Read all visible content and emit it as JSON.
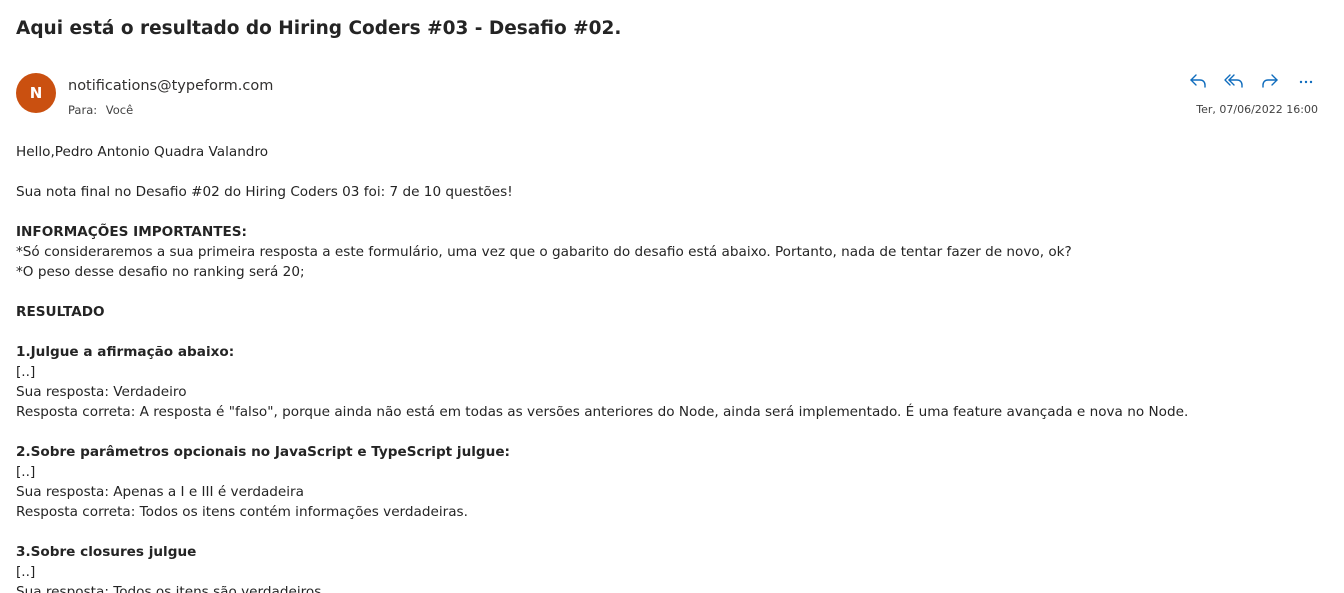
{
  "email": {
    "subject": "Aqui está o resultado do Hiring Coders #03 - Desafio #02.",
    "avatar_initial": "N",
    "avatar_color": "#ca5010",
    "sender": "notifications@typeform.com",
    "to_label": "Para:",
    "to_value": "Você",
    "date": "Ter, 07/06/2022 16:00",
    "actions": [
      {
        "name": "reply",
        "icon": "reply-icon"
      },
      {
        "name": "reply-all",
        "icon": "reply-all-icon"
      },
      {
        "name": "forward",
        "icon": "forward-icon"
      },
      {
        "name": "more",
        "icon": "more-icon"
      }
    ],
    "accent_color": "#0f6cbd"
  },
  "body": {
    "greeting": "Hello,Pedro Antonio Quadra Valandro",
    "score": "Sua nota final no Desafio #02 do Hiring Coders 03 foi: 7 de 10 questões!",
    "info_heading": "INFORMAÇÕES IMPORTANTES:",
    "info_line1": "*Só consideraremos a sua primeira resposta a este formulário, uma vez que o gabarito do desafio está abaixo. Portanto, nada de tentar fazer de novo, ok?",
    "info_line2": "*O peso desse desafio no ranking será 20;",
    "result_heading": "RESULTADO",
    "questions": [
      {
        "title": "1.Julgue a afirmação abaixo:",
        "ellipsis": "[..]",
        "your_answer": "Sua resposta: Verdadeiro",
        "correct_answer": "Resposta correta: A resposta é \"falso\", porque ainda não está em todas as versões anteriores do Node, ainda será implementado. É uma feature avançada e nova no Node."
      },
      {
        "title": "2.Sobre parâmetros opcionais no JavaScript e TypeScript julgue:",
        "ellipsis": "[..]",
        "your_answer": "Sua resposta: Apenas a I e III é verdadeira",
        "correct_answer": "Resposta correta: Todos os itens contém informações verdadeiras."
      },
      {
        "title": "3.Sobre closures julgue",
        "ellipsis": "[..]",
        "your_answer": "Sua resposta: Todos os itens são verdadeiros"
      }
    ]
  }
}
